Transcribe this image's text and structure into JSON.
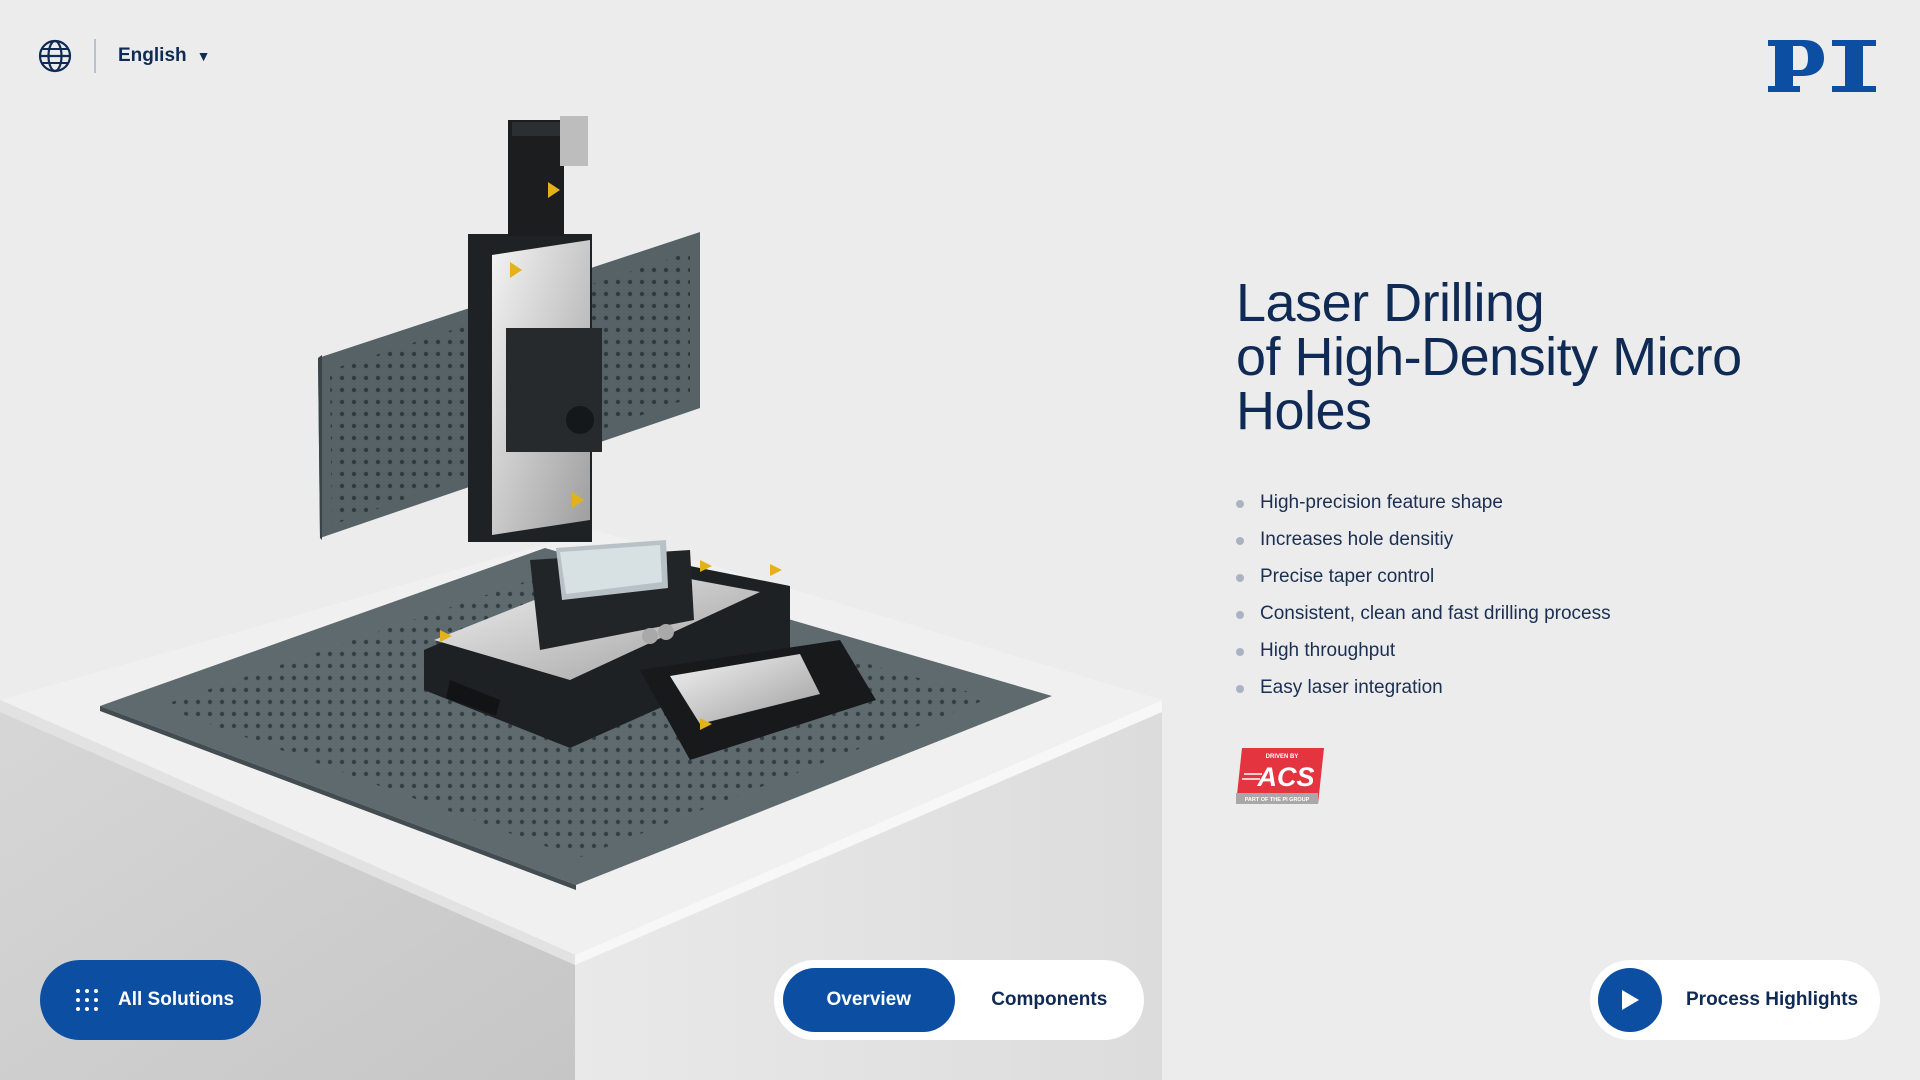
{
  "header": {
    "language_label": "English",
    "language_icon": "globe-icon",
    "caret_icon": "caret-down-icon",
    "logo_text": "PI"
  },
  "hero": {
    "title_lines": [
      "Laser Drilling",
      "of High-Density Micro",
      "Holes"
    ],
    "features": [
      "High-precision feature shape",
      "Increases hole densitiy",
      "Precise taper control",
      "Consistent, clean and fast drilling process",
      "High throughput",
      "Easy laser integration"
    ],
    "badge": {
      "top": "DRIVEN BY",
      "main": "ACS",
      "bottom": "PART OF THE PI GROUP"
    }
  },
  "footer": {
    "solutions_label": "All Solutions",
    "tabs": [
      {
        "label": "Overview",
        "active": true
      },
      {
        "label": "Components",
        "active": false
      }
    ],
    "highlights_label": "Process Highlights"
  },
  "colors": {
    "brand_blue": "#0b4ea2",
    "text_navy": "#0f2a55",
    "background": "#ececec",
    "badge_red": "#e3343f"
  }
}
